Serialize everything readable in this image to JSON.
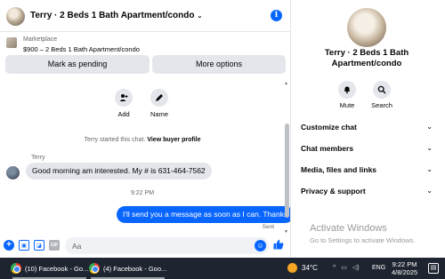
{
  "header": {
    "title": "Terry · 2 Beds 1 Bath Apartment/condo",
    "chevron": "⌄",
    "info_icon": "i"
  },
  "marketplace": {
    "label": "Marketplace",
    "listing": "$900 – 2 Beds 1 Bath Apartment/condo",
    "buttons": {
      "pending": "Mark as pending",
      "options": "More options"
    }
  },
  "chat": {
    "actions": [
      {
        "label": "Add",
        "icon": "person-add-icon"
      },
      {
        "label": "Name",
        "icon": "pencil-icon"
      }
    ],
    "started_text": "Terry started this chat.",
    "started_link": "View buyer profile",
    "sender": "Terry",
    "incoming_message": "Good morning am interested. My # is 631-464-7562",
    "time": "9:22 PM",
    "outgoing_message": "I'll send you a message as soon as I can. Thanks",
    "status": "Sent"
  },
  "composer": {
    "placeholder": "Aa",
    "gif_label": "GIF"
  },
  "info_panel": {
    "name": "Terry · 2 Beds 1 Bath Apartment/condo",
    "actions": [
      {
        "label": "Mute",
        "icon": "bell-icon"
      },
      {
        "label": "Search",
        "icon": "search-icon"
      }
    ],
    "menu": [
      "Customize chat",
      "Chat members",
      "Media, files and links",
      "Privacy & support"
    ],
    "watermark_title": "Activate Windows",
    "watermark_sub": "Go to Settings to activate Windows."
  },
  "taskbar": {
    "tasks": [
      "(10) Facebook - Go...",
      "(4) Facebook - Goo..."
    ],
    "temperature": "34°C",
    "language": "ENG",
    "time": "9:22 PM",
    "date": "4/8/2025"
  },
  "colors": {
    "accent": "#0866ff",
    "bubble_in": "#e4e6eb",
    "taskbar": "#1f2530"
  }
}
